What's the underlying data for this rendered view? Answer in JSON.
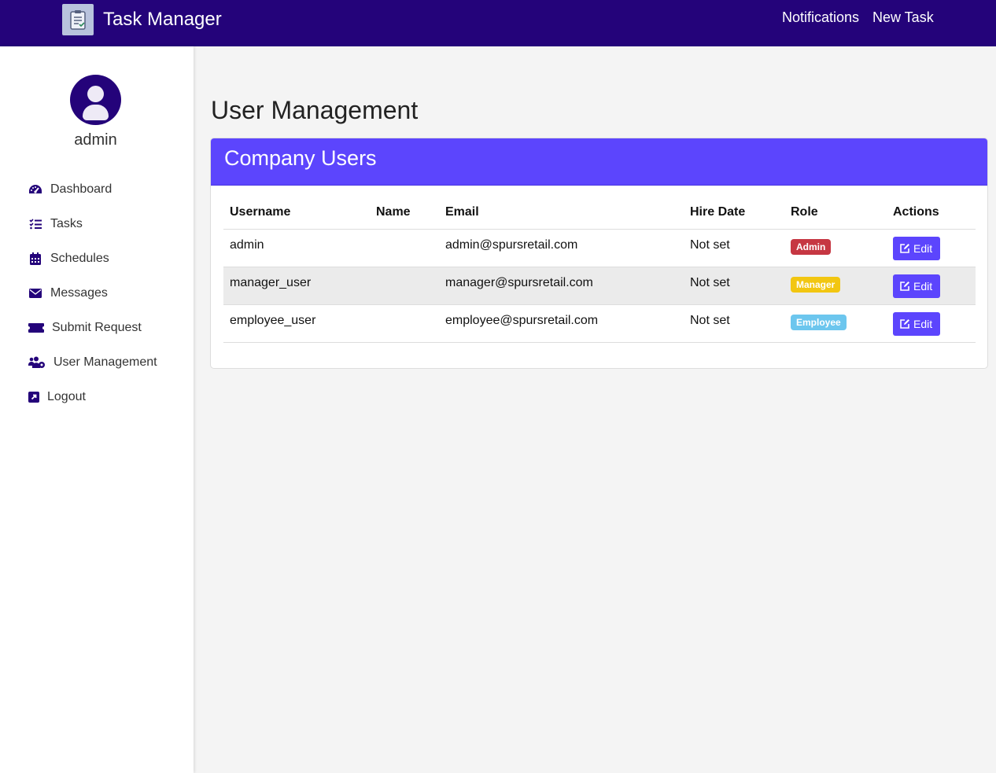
{
  "app": {
    "title": "Task Manager",
    "logo_icon": "clipboard-list-icon"
  },
  "topnav": {
    "notifications": "Notifications",
    "new_task": "New Task"
  },
  "sidebar": {
    "username": "admin",
    "avatar_icon": "user-circle-icon",
    "items": [
      {
        "label": "Dashboard",
        "icon": "tachometer-icon"
      },
      {
        "label": "Tasks",
        "icon": "tasks-list-icon"
      },
      {
        "label": "Schedules",
        "icon": "calendar-icon"
      },
      {
        "label": "Messages",
        "icon": "envelope-icon"
      },
      {
        "label": "Submit Request",
        "icon": "ticket-icon"
      },
      {
        "label": "User Management",
        "icon": "users-cog-icon"
      },
      {
        "label": "Logout",
        "icon": "external-link-icon"
      }
    ]
  },
  "main": {
    "page_title": "User Management",
    "card_title": "Company Users",
    "columns": [
      "Username",
      "Name",
      "Email",
      "Hire Date",
      "Role",
      "Actions"
    ],
    "rows": [
      {
        "username": "admin",
        "name": "",
        "email": "admin@spursretail.com",
        "hire_date": "Not set",
        "role": "Admin",
        "action": "Edit"
      },
      {
        "username": "manager_user",
        "name": "",
        "email": "manager@spursretail.com",
        "hire_date": "Not set",
        "role": "Manager",
        "action": "Edit"
      },
      {
        "username": "employee_user",
        "name": "",
        "email": "employee@spursretail.com",
        "hire_date": "Not set",
        "role": "Employee",
        "action": "Edit"
      }
    ]
  },
  "colors": {
    "navbar": "#24037a",
    "accent": "#5c45fd",
    "admin_badge": "#c63742",
    "manager_badge": "#f2c611",
    "employee_badge": "#6cc6ee"
  }
}
